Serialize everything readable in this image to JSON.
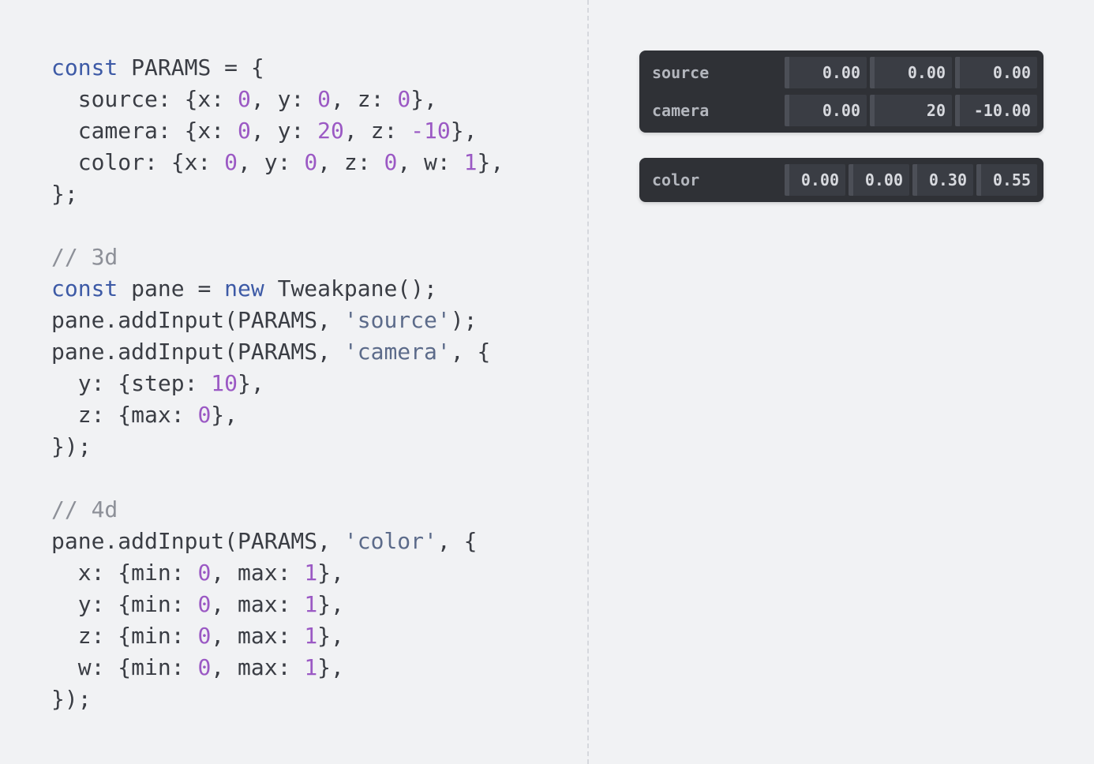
{
  "code_lines": [
    [
      {
        "t": "const",
        "c": "kw"
      },
      {
        "t": " PARAMS = {",
        "c": "pl"
      }
    ],
    [
      {
        "t": "  source: {x: ",
        "c": "pl"
      },
      {
        "t": "0",
        "c": "num"
      },
      {
        "t": ", y: ",
        "c": "pl"
      },
      {
        "t": "0",
        "c": "num"
      },
      {
        "t": ", z: ",
        "c": "pl"
      },
      {
        "t": "0",
        "c": "num"
      },
      {
        "t": "},",
        "c": "pl"
      }
    ],
    [
      {
        "t": "  camera: {x: ",
        "c": "pl"
      },
      {
        "t": "0",
        "c": "num"
      },
      {
        "t": ", y: ",
        "c": "pl"
      },
      {
        "t": "20",
        "c": "num"
      },
      {
        "t": ", z: ",
        "c": "pl"
      },
      {
        "t": "-10",
        "c": "num"
      },
      {
        "t": "},",
        "c": "pl"
      }
    ],
    [
      {
        "t": "  color: {x: ",
        "c": "pl"
      },
      {
        "t": "0",
        "c": "num"
      },
      {
        "t": ", y: ",
        "c": "pl"
      },
      {
        "t": "0",
        "c": "num"
      },
      {
        "t": ", z: ",
        "c": "pl"
      },
      {
        "t": "0",
        "c": "num"
      },
      {
        "t": ", w: ",
        "c": "pl"
      },
      {
        "t": "1",
        "c": "num"
      },
      {
        "t": "},",
        "c": "pl"
      }
    ],
    [
      {
        "t": "};",
        "c": "pl"
      }
    ],
    [],
    [
      {
        "t": "// 3d",
        "c": "cmt"
      }
    ],
    [
      {
        "t": "const",
        "c": "kw"
      },
      {
        "t": " pane = ",
        "c": "pl"
      },
      {
        "t": "new",
        "c": "kw"
      },
      {
        "t": " Tweakpane();",
        "c": "pl"
      }
    ],
    [
      {
        "t": "pane.addInput(PARAMS, ",
        "c": "pl"
      },
      {
        "t": "'source'",
        "c": "str"
      },
      {
        "t": ");",
        "c": "pl"
      }
    ],
    [
      {
        "t": "pane.addInput(PARAMS, ",
        "c": "pl"
      },
      {
        "t": "'camera'",
        "c": "str"
      },
      {
        "t": ", {",
        "c": "pl"
      }
    ],
    [
      {
        "t": "  y: {step: ",
        "c": "pl"
      },
      {
        "t": "10",
        "c": "num"
      },
      {
        "t": "},",
        "c": "pl"
      }
    ],
    [
      {
        "t": "  z: {max: ",
        "c": "pl"
      },
      {
        "t": "0",
        "c": "num"
      },
      {
        "t": "},",
        "c": "pl"
      }
    ],
    [
      {
        "t": "});",
        "c": "pl"
      }
    ],
    [],
    [
      {
        "t": "// 4d",
        "c": "cmt"
      }
    ],
    [
      {
        "t": "pane.addInput(PARAMS, ",
        "c": "pl"
      },
      {
        "t": "'color'",
        "c": "str"
      },
      {
        "t": ", {",
        "c": "pl"
      }
    ],
    [
      {
        "t": "  x: {min: ",
        "c": "pl"
      },
      {
        "t": "0",
        "c": "num"
      },
      {
        "t": ", max: ",
        "c": "pl"
      },
      {
        "t": "1",
        "c": "num"
      },
      {
        "t": "},",
        "c": "pl"
      }
    ],
    [
      {
        "t": "  y: {min: ",
        "c": "pl"
      },
      {
        "t": "0",
        "c": "num"
      },
      {
        "t": ", max: ",
        "c": "pl"
      },
      {
        "t": "1",
        "c": "num"
      },
      {
        "t": "},",
        "c": "pl"
      }
    ],
    [
      {
        "t": "  z: {min: ",
        "c": "pl"
      },
      {
        "t": "0",
        "c": "num"
      },
      {
        "t": ", max: ",
        "c": "pl"
      },
      {
        "t": "1",
        "c": "num"
      },
      {
        "t": "},",
        "c": "pl"
      }
    ],
    [
      {
        "t": "  w: {min: ",
        "c": "pl"
      },
      {
        "t": "0",
        "c": "num"
      },
      {
        "t": ", max: ",
        "c": "pl"
      },
      {
        "t": "1",
        "c": "num"
      },
      {
        "t": "},",
        "c": "pl"
      }
    ],
    [
      {
        "t": "});",
        "c": "pl"
      }
    ]
  ],
  "colors": {
    "keyword": "#3d5aa6",
    "number": "#9b59c4",
    "string": "#5c6b8a",
    "comment": "#8d9098",
    "pane_background": "#2f3136"
  },
  "pane_3d": {
    "rows": [
      {
        "label": "source",
        "values": [
          "0.00",
          "0.00",
          "0.00"
        ]
      },
      {
        "label": "camera",
        "values": [
          "0.00",
          "20",
          "-10.00"
        ]
      }
    ]
  },
  "pane_4d": {
    "rows": [
      {
        "label": "color",
        "values": [
          "0.00",
          "0.00",
          "0.30",
          "0.55"
        ]
      }
    ]
  }
}
